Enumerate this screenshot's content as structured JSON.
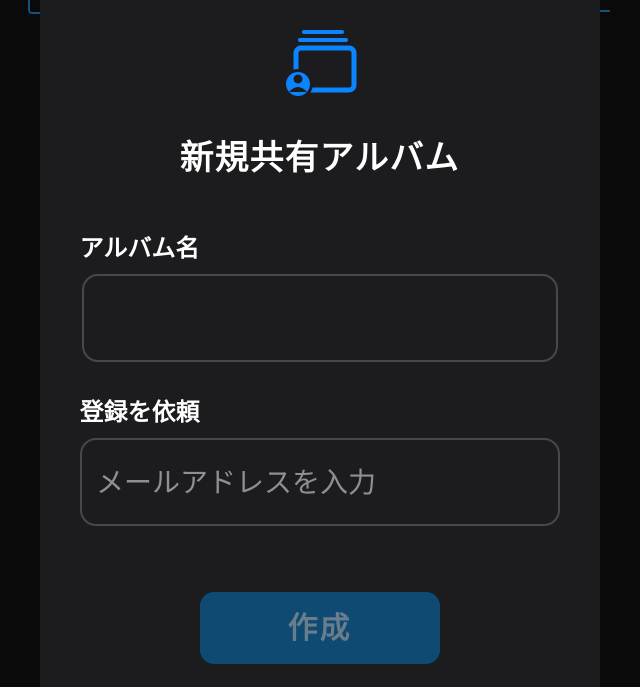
{
  "dialog": {
    "title": "新規共有アルバム",
    "icon": "shared-album-icon",
    "accent_color": "#0a84ff"
  },
  "album_name": {
    "label": "アルバム名",
    "value": "",
    "placeholder": ""
  },
  "invite": {
    "label": "登録を依頼",
    "value": "",
    "placeholder": "メールアドレスを入力"
  },
  "create_button": {
    "label": "作成",
    "enabled": false
  }
}
